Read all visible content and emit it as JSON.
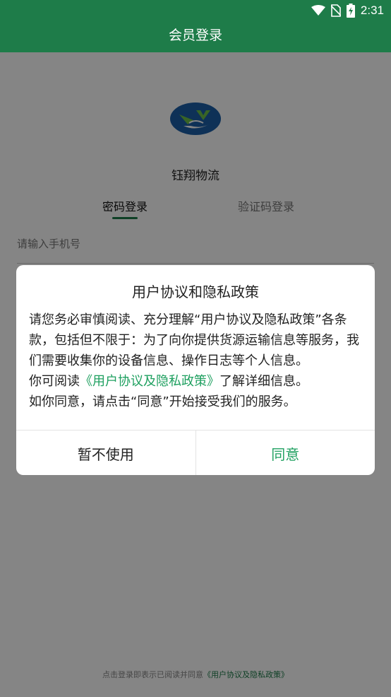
{
  "status_bar": {
    "time": "2:31",
    "icons": [
      "wifi-icon",
      "no-sim-icon",
      "battery-charging-icon"
    ]
  },
  "header": {
    "title": "会员登录"
  },
  "login": {
    "company_name": "钰翔物流",
    "tabs": [
      {
        "label": "密码登录",
        "active": true
      },
      {
        "label": "验证码登录",
        "active": false
      }
    ],
    "phone_placeholder": "请输入手机号"
  },
  "footer": {
    "text": "点击登录即表示已阅读并同意",
    "link": "《用户协议及隐私政策》"
  },
  "dialog": {
    "title": "用户协议和隐私政策",
    "paragraph1": "请您务必审慎阅读、充分理解“用户协议及隐私政策”各条款，包括但不限于：为了向你提供货源运输信息等服务，我们需要收集你的设备信息、操作日志等个人信息。",
    "paragraph2_prefix": "你可阅读",
    "paragraph2_link": "《用户协议及隐私政策》",
    "paragraph2_suffix": "了解详细信息。",
    "paragraph3": "如你同意，请点击“同意”开始接受我们的服务。",
    "cancel_label": "暂不使用",
    "agree_label": "同意"
  },
  "colors": {
    "brand": "#1e7c49",
    "accent": "#1fa060",
    "overlay": "rgba(0,0,0,0.48)"
  }
}
